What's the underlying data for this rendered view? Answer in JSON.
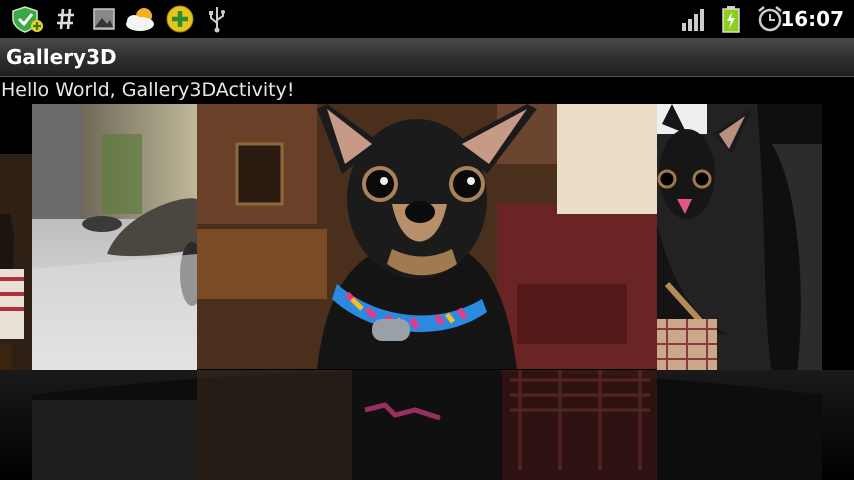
{
  "status_bar": {
    "left_icons": [
      "shield-check-icon",
      "hash-icon",
      "image-icon",
      "weather-sun-cloud-icon",
      "add-circle-icon",
      "usb-icon"
    ],
    "right_icons": [
      "signal-bars-icon",
      "battery-charging-icon",
      "alarm-clock-icon"
    ],
    "time": "16:07"
  },
  "app": {
    "title": "Gallery3D",
    "hello_text": "Hello World, Gallery3DActivity!"
  },
  "gallery": {
    "items": [
      {
        "subject": "dog-on-left-edge"
      },
      {
        "subject": "cat-on-carpet"
      },
      {
        "subject": "chihuahua-with-collar"
      },
      {
        "subject": "chihuahua-in-car-seat"
      }
    ],
    "selected_index": 2
  },
  "colors": {
    "status_bg": "#000000",
    "title_bg": "#2e2e2e",
    "accent_battery": "#8ccf1e"
  }
}
